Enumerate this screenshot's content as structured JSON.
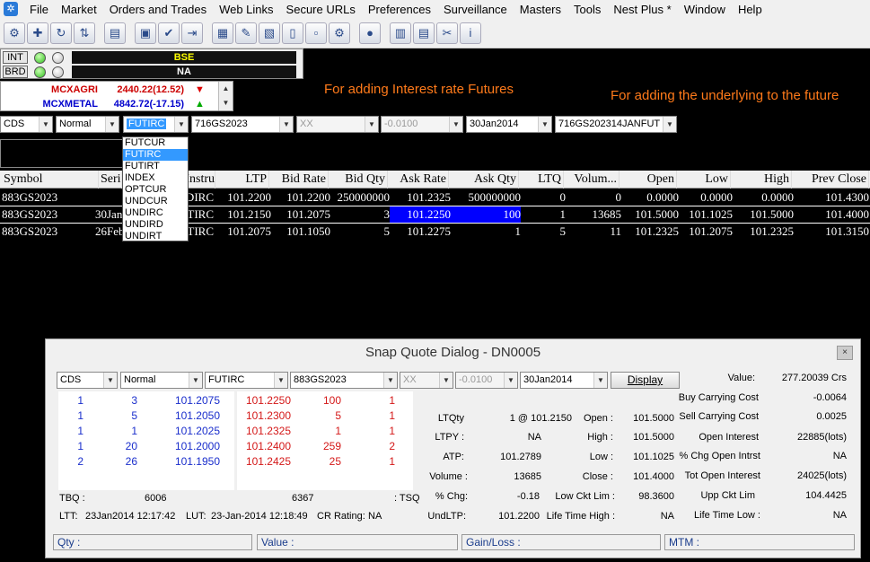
{
  "menu": [
    "File",
    "Market",
    "Orders and Trades",
    "Web Links",
    "Secure URLs",
    "Preferences",
    "Surveillance",
    "Masters",
    "Tools",
    "Nest Plus *",
    "Window",
    "Help"
  ],
  "status": {
    "row1_label": "INT",
    "row2_label": "BRD",
    "exchange1": "BSE",
    "exchange2": "NA",
    "exchange1_color": "#ffff00",
    "exchange2_color": "#ffffff"
  },
  "ticker": [
    {
      "name": "MCXAGRI",
      "value": "2440.22(12.52)",
      "dir": "▼",
      "color": "#dd0000",
      "dir_color": "#dd0000"
    },
    {
      "name": "MCXMETAL",
      "value": "4842.72(-17.15)",
      "dir": "▲",
      "color": "#0000cc",
      "dir_color": "#00aa00"
    }
  ],
  "selection": {
    "exchange": "CDS",
    "book": "Normal",
    "instrument": "FUTIRC",
    "symbol": "716GS2023",
    "option_type": "XX",
    "strike": "-0.0100",
    "expiry": "30Jan2014",
    "contract": "716GS202314JANFUT"
  },
  "instrument_options": [
    "FUTCUR",
    "FUTIRC",
    "FUTIRT",
    "INDEX",
    "OPTCUR",
    "UNDCUR",
    "UNDIRC",
    "UNDIRD",
    "UNDIRT"
  ],
  "annotations": {
    "a1": "For adding Interest rate Futures",
    "a2": "For adding the underlying to the future"
  },
  "market_watch": {
    "columns": [
      "Symbol",
      "Seri",
      "Instru...",
      "LTP",
      "Bid Rate",
      "Bid Qty",
      "Ask Rate",
      "Ask Qty",
      "LTQ",
      "Volum...",
      "Open",
      "Low",
      "High",
      "Prev Close"
    ],
    "rows": [
      [
        "883GS2023",
        "",
        "UNDIRC",
        "101.2200",
        "101.2200",
        "250000000",
        "101.2325",
        "500000000",
        "0",
        "0",
        "0.0000",
        "0.0000",
        "0.0000",
        "101.4300"
      ],
      [
        "883GS2023",
        "30Jan2014",
        "FUTIRC",
        "101.2150",
        "101.2075",
        "3",
        "101.2250",
        "100",
        "1",
        "13685",
        "101.5000",
        "101.1025",
        "101.5000",
        "101.4000"
      ],
      [
        "883GS2023",
        "26Feb2014",
        "FUTIRC",
        "101.2075",
        "101.1050",
        "5",
        "101.2275",
        "1",
        "5",
        "11",
        "101.2325",
        "101.2075",
        "101.2325",
        "101.3150"
      ]
    ]
  },
  "snap_quote": {
    "title": "Snap Quote Dialog - DN0005",
    "close": "×",
    "exchange": "CDS",
    "book": "Normal",
    "instrument": "FUTIRC",
    "symbol": "883GS2023",
    "option_type": "XX",
    "strike": "-0.0100",
    "expiry": "30Jan2014",
    "display_label": "Display",
    "bids": [
      [
        "1",
        "3",
        "101.2075"
      ],
      [
        "1",
        "5",
        "101.2050"
      ],
      [
        "1",
        "1",
        "101.2025"
      ],
      [
        "1",
        "20",
        "101.2000"
      ],
      [
        "2",
        "26",
        "101.1950"
      ]
    ],
    "asks": [
      [
        "101.2250",
        "100",
        "1"
      ],
      [
        "101.2300",
        "5",
        "1"
      ],
      [
        "101.2325",
        "1",
        "1"
      ],
      [
        "101.2400",
        "259",
        "2"
      ],
      [
        "101.2425",
        "25",
        "1"
      ]
    ],
    "tbq_label": "TBQ :",
    "tbq": "6006",
    "tsq": "6367",
    "tsq_label": ": TSQ",
    "ltt_label": "LTT:",
    "ltt": "23Jan2014 12:17:42",
    "lut_label": "LUT:",
    "lut": "23-Jan-2014 12:18:49",
    "cr_label": "CR Rating:",
    "cr": "NA",
    "mid": [
      [
        "LTQty",
        "1 @ 101.2150",
        "Open :",
        "101.5000"
      ],
      [
        "LTPY :",
        "NA",
        "High :",
        "101.5000"
      ],
      [
        "ATP:",
        "101.2789",
        "Low :",
        "101.1025"
      ],
      [
        "Volume :",
        "13685",
        "Close :",
        "101.4000"
      ],
      [
        "% Chg:",
        "-0.18",
        "Low Ckt Lim :",
        "98.3600"
      ],
      [
        "UndLTP:",
        "101.2200",
        "Life Time High :",
        "NA"
      ]
    ],
    "right": [
      [
        "Value:",
        "277.20039 Crs"
      ],
      [
        "Buy Carrying Cost",
        "-0.0064"
      ],
      [
        "Sell Carrying Cost",
        "0.0025"
      ],
      [
        "Open Interest",
        "22885(lots)"
      ],
      [
        "% Chg Open Intrst",
        "NA"
      ],
      [
        "Tot Open Interest",
        "24025(lots)"
      ],
      [
        "Upp Ckt Lim",
        "104.4425"
      ],
      [
        "Life Time Low :",
        "NA"
      ]
    ],
    "footer": [
      "Qty :",
      "Value :",
      "Gain/Loss :",
      "MTM :"
    ]
  }
}
